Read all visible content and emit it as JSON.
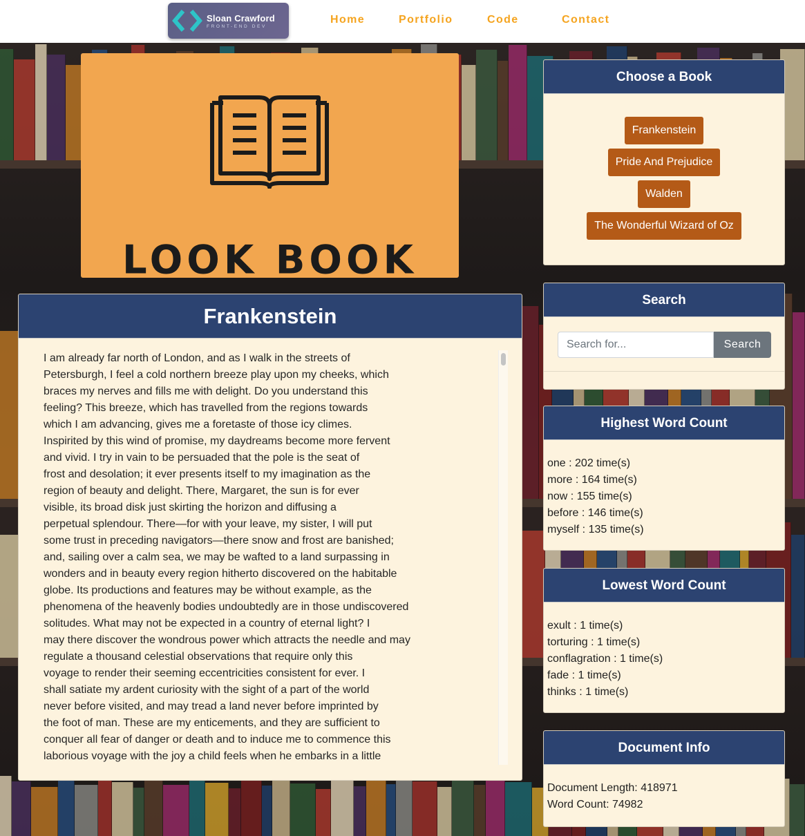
{
  "nav": {
    "logo_name": "Sloan Crawford",
    "logo_sub": "FRONT-END DEV",
    "links": [
      "Home",
      "Portfolio",
      "Code",
      "Contact"
    ],
    "link_color": "#f5a41f"
  },
  "hero": {
    "title": "LOOK BOOK",
    "icon": "open-book-icon",
    "bg_color": "#f2a64f"
  },
  "reader": {
    "title": "Frankenstein",
    "lines": [
      "I am already far north of London, and as I walk in the streets of",
      "Petersburgh, I feel a cold northern breeze play upon my cheeks, which",
      "braces my nerves and fills me with delight. Do you understand this",
      "feeling? This breeze, which has travelled from the regions towards",
      "which I am advancing, gives me a foretaste of those icy climes.",
      "Inspirited by this wind of promise, my daydreams become more fervent",
      "and vivid. I try in vain to be persuaded that the pole is the seat of",
      "frost and desolation; it ever presents itself to my imagination as the",
      "region of beauty and delight. There, Margaret, the sun is for ever",
      "visible, its broad disk just skirting the horizon and diffusing a",
      "perpetual splendour. There—for with your leave, my sister, I will put",
      "some trust in preceding navigators—there snow and frost are banished;",
      "and, sailing over a calm sea, we may be wafted to a land surpassing in",
      "wonders and in beauty every region hitherto discovered on the habitable",
      "globe. Its productions and features may be without example, as the",
      "phenomena of the heavenly bodies undoubtedly are in those undiscovered",
      "solitudes. What may not be expected in a country of eternal light? I",
      "may there discover the wondrous power which attracts the needle and may",
      "regulate a thousand celestial observations that require only this",
      "voyage to render their seeming eccentricities consistent for ever. I",
      "shall satiate my ardent curiosity with the sight of a part of the world",
      "never before visited, and may tread a land never before imprinted by",
      "the foot of man. These are my enticements, and they are sufficient to",
      "conquer all fear of danger or death and to induce me to commence this",
      "laborious voyage with the joy a child feels when he embarks in a little"
    ]
  },
  "choose_book": {
    "title": "Choose a Book",
    "books": [
      "Frankenstein",
      "Pride And Prejudice",
      "Walden",
      "The Wonderful Wizard of Oz"
    ],
    "button_color": "#b45a17"
  },
  "search": {
    "title": "Search",
    "placeholder": "Search for...",
    "button_label": "Search"
  },
  "highest_word_count": {
    "title": "Highest Word Count",
    "items": [
      "one : 202 time(s)",
      "more : 164 time(s)",
      "now : 155 time(s)",
      "before : 146 time(s)",
      "myself : 135 time(s)"
    ]
  },
  "lowest_word_count": {
    "title": "Lowest Word Count",
    "items": [
      "exult : 1 time(s)",
      "torturing : 1 time(s)",
      "conflagration : 1 time(s)",
      "fade : 1 time(s)",
      "thinks : 1 time(s)"
    ]
  },
  "document_info": {
    "title": "Document Info",
    "length": "Document Length: 418971",
    "word_count": "Word Count: 74982"
  },
  "colors": {
    "panel_header": "#2c4371",
    "panel_body": "#fdf3de"
  }
}
